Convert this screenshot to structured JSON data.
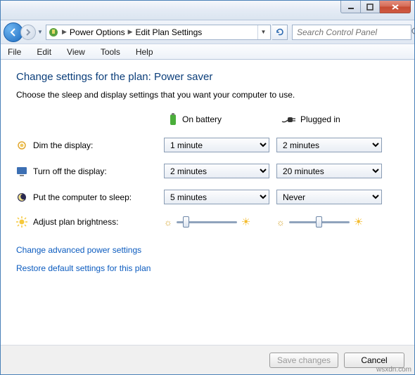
{
  "breadcrumb": {
    "item1": "Power Options",
    "item2": "Edit Plan Settings"
  },
  "search": {
    "placeholder": "Search Control Panel"
  },
  "menu": {
    "file": "File",
    "edit": "Edit",
    "view": "View",
    "tools": "Tools",
    "help": "Help"
  },
  "heading": "Change settings for the plan: Power saver",
  "subtext": "Choose the sleep and display settings that you want your computer to use.",
  "columns": {
    "battery": "On battery",
    "plugged": "Plugged in"
  },
  "rows": {
    "dim": {
      "label": "Dim the display:",
      "battery": "1 minute",
      "plugged": "2 minutes"
    },
    "turnoff": {
      "label": "Turn off the display:",
      "battery": "2 minutes",
      "plugged": "20 minutes"
    },
    "sleep": {
      "label": "Put the computer to sleep:",
      "battery": "5 minutes",
      "plugged": "Never"
    },
    "brightness": {
      "label": "Adjust plan brightness:",
      "battery_pct": 12,
      "plugged_pct": 50
    }
  },
  "links": {
    "advanced": "Change advanced power settings",
    "restore": "Restore default settings for this plan"
  },
  "buttons": {
    "save": "Save changes",
    "cancel": "Cancel"
  },
  "watermark": "wsxdn.com"
}
